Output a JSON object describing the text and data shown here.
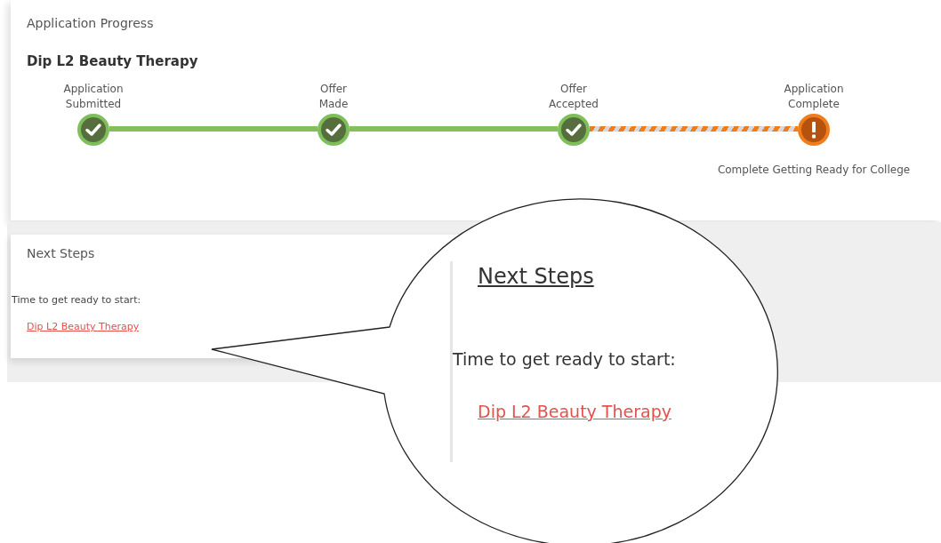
{
  "progress": {
    "title": "Application Progress",
    "course": "Dip L2 Beauty Therapy",
    "steps": [
      {
        "label": "Application\nSubmitted",
        "kind": "done"
      },
      {
        "label": "Offer\nMade",
        "kind": "done"
      },
      {
        "label": "Offer\nAccepted",
        "kind": "done"
      },
      {
        "label": "Application\nComplete",
        "kind": "action",
        "note": "Complete Getting Ready for College"
      }
    ]
  },
  "next_steps": {
    "title": "Next Steps",
    "intro": "Time to get ready to start:",
    "link": "Dip L2 Beauty Therapy"
  },
  "callout": {
    "title": "Next Steps",
    "intro": "Time to get ready to start:",
    "link": "Dip L2 Beauty Therapy"
  }
}
